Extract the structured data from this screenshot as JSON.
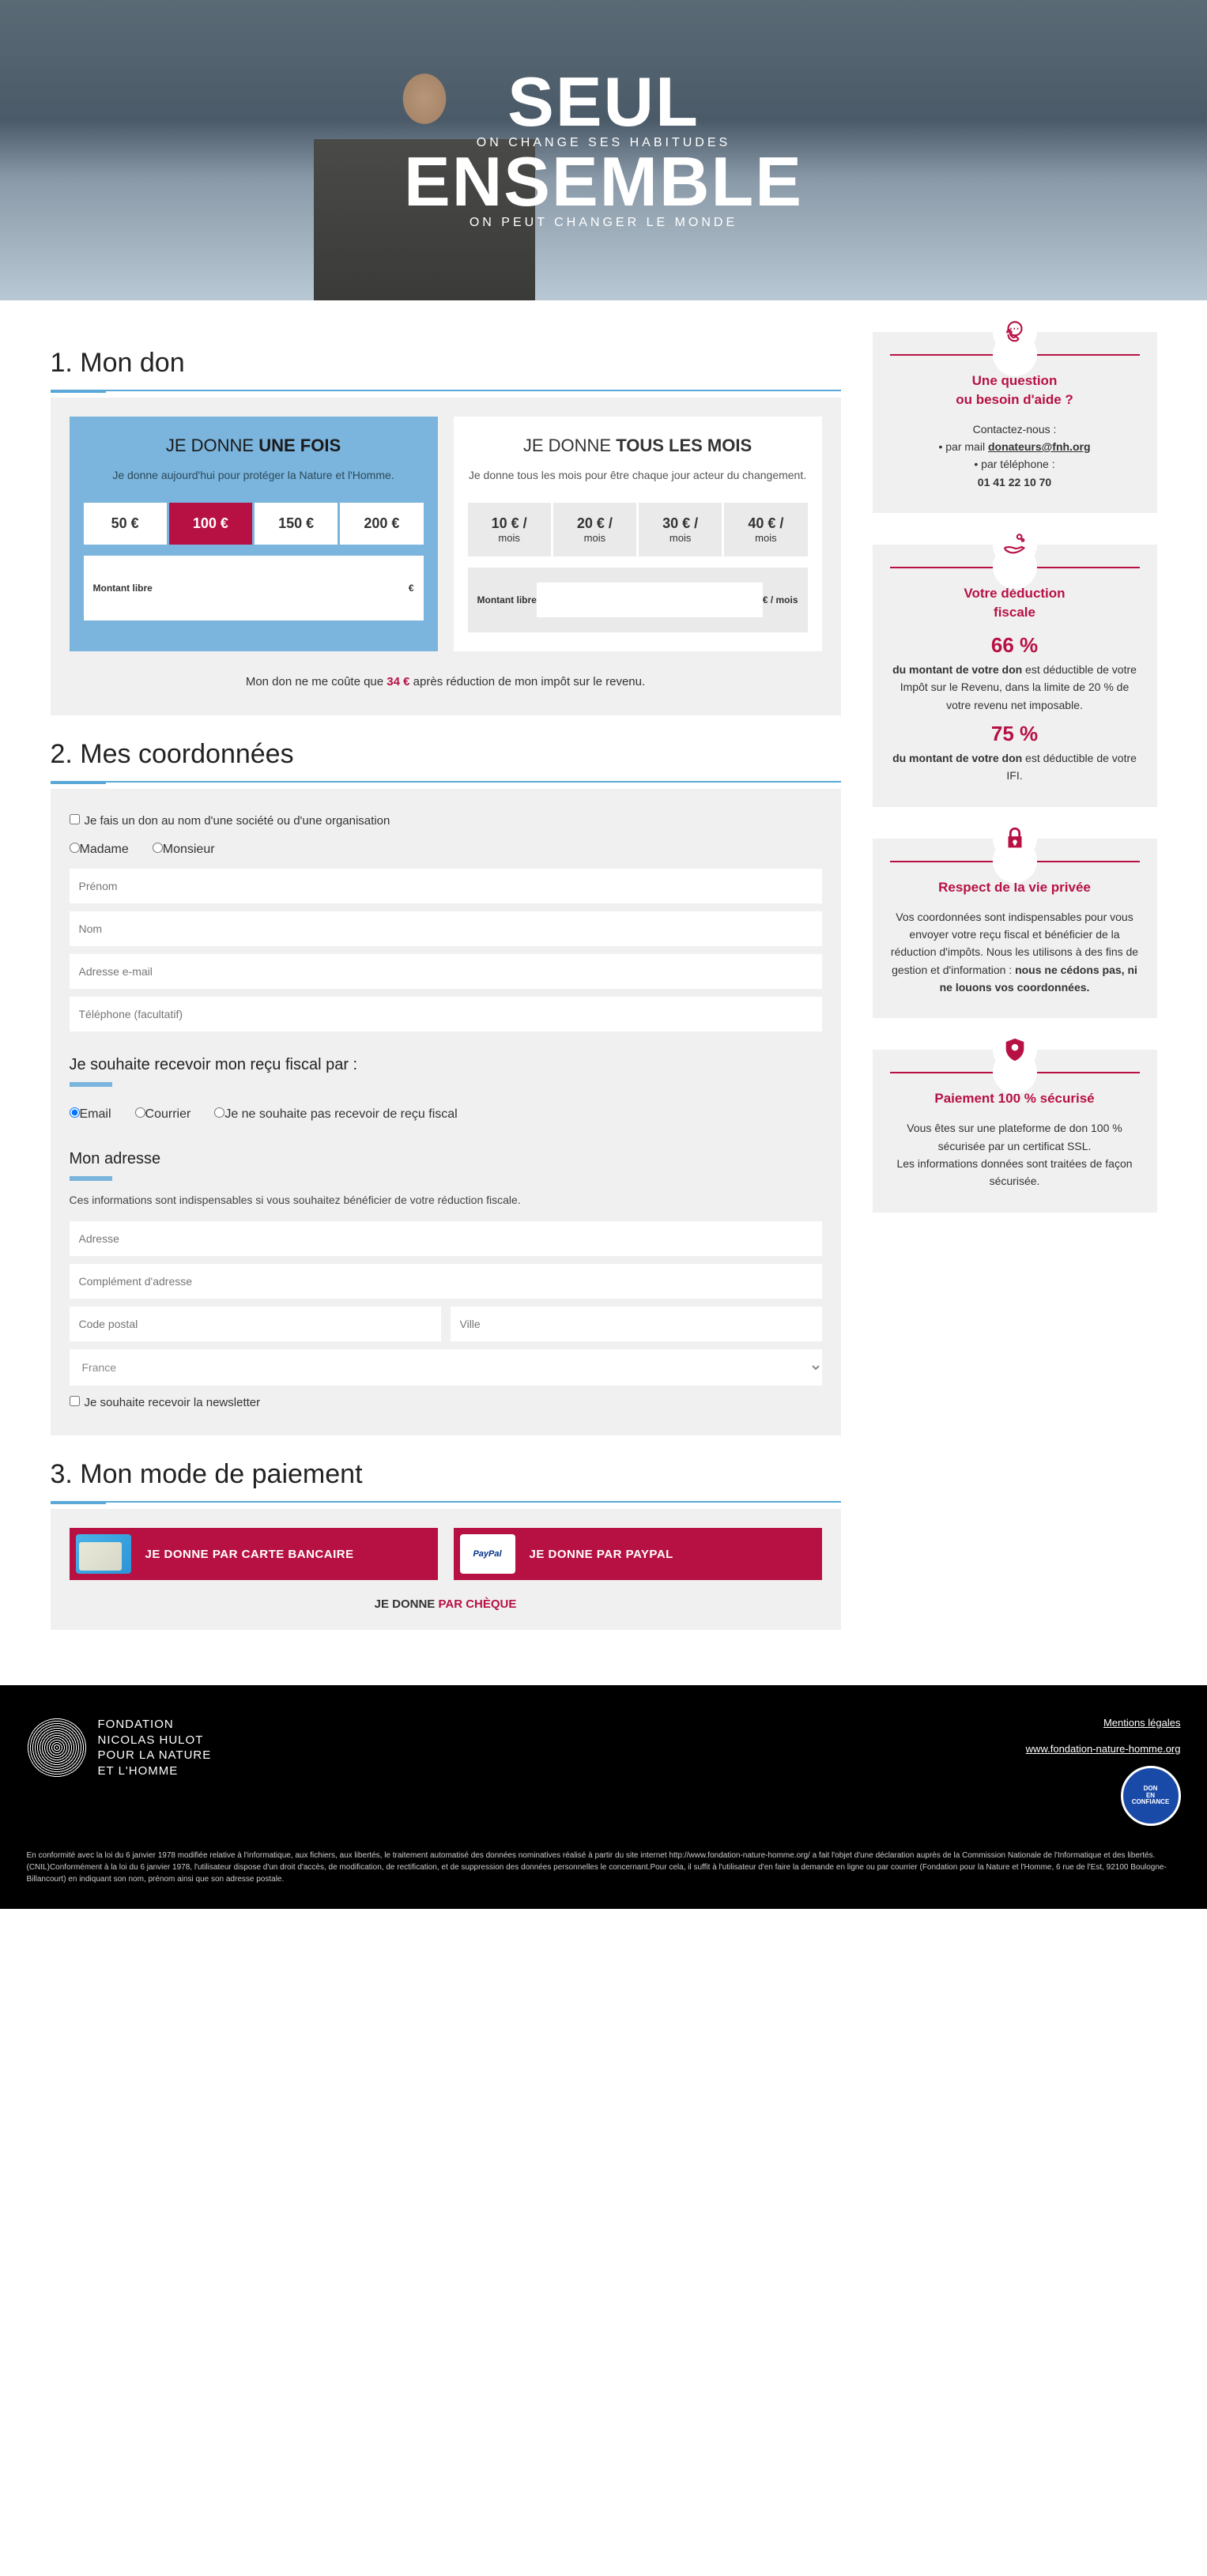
{
  "hero": {
    "line1": "SEUL",
    "sub1": "ON CHANGE SES HABITUDES",
    "line2": "ENSEMBLE",
    "sub2": "ON PEUT CHANGER LE MONDE"
  },
  "section1": {
    "title": "1. Mon don",
    "tab1": {
      "title_a": "JE DONNE ",
      "title_b": "UNE FOIS",
      "desc": "Je donne aujourd'hui pour protéger la Nature et l'Homme.",
      "amounts": [
        "50 €",
        "100 €",
        "150 €",
        "200 €"
      ],
      "free": "Montant libre",
      "unit": "€"
    },
    "tab2": {
      "title_a": "JE DONNE ",
      "title_b": "TOUS LES MOIS",
      "desc": "Je donne tous les mois pour être chaque jour acteur du changement.",
      "amounts": [
        "10 € /",
        "20 € /",
        "30 € /",
        "40 € /"
      ],
      "sub": "mois",
      "free": "Montant libre",
      "unit": "€ / mois"
    },
    "cost_a": "Mon don ne me coûte que ",
    "cost_b": "34 €",
    "cost_c": " après réduction de mon impôt sur le revenu."
  },
  "section2": {
    "title": "2. Mes coordonnées",
    "org": "Je fais un don au nom d'une société ou d'une organisation",
    "civ": {
      "f": "Madame",
      "m": "Monsieur"
    },
    "fields": {
      "first": "Prénom",
      "last": "Nom",
      "email": "Adresse e-mail",
      "phone": "Téléphone (facultatif)"
    },
    "receipt_title": "Je souhaite recevoir mon reçu fiscal par :",
    "receipt": {
      "email": "Email",
      "mail": "Courrier",
      "none": "Je ne souhaite pas recevoir de reçu fiscal"
    },
    "addr_title": "Mon adresse",
    "addr_note": "Ces informations sont indispensables si vous souhaitez bénéficier de votre réduction fiscale.",
    "addr": {
      "a": "Adresse",
      "b": "Complément d'adresse",
      "zip": "Code postal",
      "city": "Ville",
      "country": "France"
    },
    "news": "Je souhaite recevoir la newsletter"
  },
  "section3": {
    "title": "3. Mon mode de paiement",
    "cc": "JE DONNE PAR CARTE BANCAIRE",
    "pp": "JE DONNE PAR PAYPAL",
    "pp_label": "PayPal",
    "cheque_a": "JE DONNE ",
    "cheque_b": "PAR CHÈQUE"
  },
  "side": {
    "q": {
      "title": "Une question\nou besoin d'aide ?",
      "contact": "Contactez-nous :",
      "mail_a": "• par mail ",
      "mail_b": "donateurs@fnh.org",
      "tel_a": "• par téléphone :",
      "tel_b": "01 41 22 10 70"
    },
    "ded": {
      "title": "Votre déduction\nfiscale",
      "p1": "66 %",
      "t1a": "du montant de votre don",
      "t1b": " est déductible de votre Impôt sur le Revenu, dans la limite de 20 % de votre revenu net imposable.",
      "p2": "75 %",
      "t2a": "du montant de votre don",
      "t2b": " est déductible de votre IFI."
    },
    "priv": {
      "title": "Respect de la vie privée",
      "t1": "Vos coordonnées sont indispensables pour vous envoyer votre reçu fiscal et bénéficier de la réduction d'impôts. Nous les utilisons à des fins de gestion et d'information : ",
      "t2": "nous ne cédons pas, ni ne louons vos coordonnées."
    },
    "sec": {
      "title": "Paiement 100 % sécurisé",
      "t": "Vous êtes sur une plateforme de don 100 % sécurisée par un certificat SSL.\nLes informations données sont traitées de façon sécurisée."
    }
  },
  "footer": {
    "org": "FONDATION\nNICOLAS HULOT\nPOUR LA NATURE\nET L'HOMME",
    "legal_link": "Mentions légales",
    "site": "www.fondation-nature-homme.org",
    "badge": "DON\nEN\nCONFIANCE",
    "text": "En conformité avec la loi du 6 janvier 1978 modifiée relative à l'informatique, aux fichiers, aux libertés, le traitement automatisé des données nominatives réalisé à partir du site internet http://www.fondation-nature-homme.org/ a fait l'objet d'une déclaration auprès de la Commission Nationale de l'Informatique et des libertés. (CNIL)Conformément à la loi du 6 janvier 1978, l'utilisateur dispose d'un droit d'accès, de modification, de rectification, et de suppression des données personnelles le concernant.Pour cela, il suffit à l'utilisateur d'en faire la demande en ligne ou par courrier (Fondation pour la Nature et l'Homme, 6 rue de l'Est, 92100 Boulogne-Billancourt) en indiquant son nom, prénom ainsi que son adresse postale."
  }
}
